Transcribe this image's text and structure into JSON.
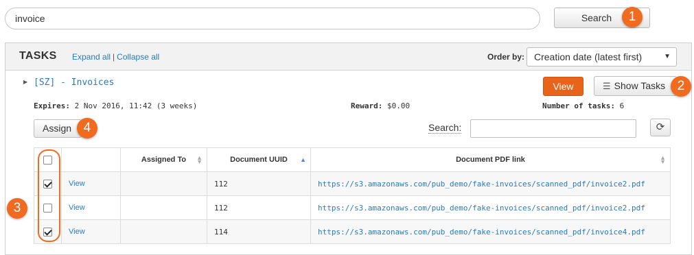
{
  "search": {
    "query": "invoice",
    "button_label": "Search"
  },
  "callouts": [
    "1",
    "2",
    "3",
    "4"
  ],
  "tasks": {
    "title": "TASKS",
    "expand_all": "Expand all",
    "separator": "|",
    "collapse_all": "Collapse all",
    "order_by_label": "Order by:",
    "order_by_value": "Creation date (latest first)",
    "group_title": "[SZ] - Invoices",
    "view_button": "View",
    "show_tasks_button": "Show Tasks",
    "expires_label": "Expires:",
    "expires_value": "2 Nov 2016, 11:42 (3 weeks)",
    "reward_label": "Reward:",
    "reward_value": "$0.00",
    "count_label": "Number of tasks:",
    "count_value": "6",
    "assign_button": "Assign",
    "table_search_label": "Search:"
  },
  "table": {
    "columns": [
      "",
      "",
      "Assigned To",
      "Document UUID",
      "Document PDF link"
    ],
    "rows": [
      {
        "checked": true,
        "action": "View",
        "assigned_to": "",
        "uuid": "112",
        "link": "https://s3.amazonaws.com/pub_demo/fake-invoices/scanned_pdf/invoice2.pdf"
      },
      {
        "checked": false,
        "action": "View",
        "assigned_to": "",
        "uuid": "112",
        "link": "https://s3.amazonaws.com/pub_demo/fake-invoices/scanned_pdf/invoice2.pdf"
      },
      {
        "checked": true,
        "action": "View",
        "assigned_to": "",
        "uuid": "114",
        "link": "https://s3.amazonaws.com/pub_demo/fake-invoices/scanned_pdf/invoice4.pdf"
      }
    ]
  },
  "colors": {
    "accent_orange": "#e8641b",
    "callout_orange": "#f06a1f",
    "link_blue": "#2a7ab8"
  },
  "icons": {
    "list": "list-icon",
    "refresh": "refresh-icon",
    "caret": "caret-right-icon",
    "dropdown": "chevron-down-icon"
  }
}
